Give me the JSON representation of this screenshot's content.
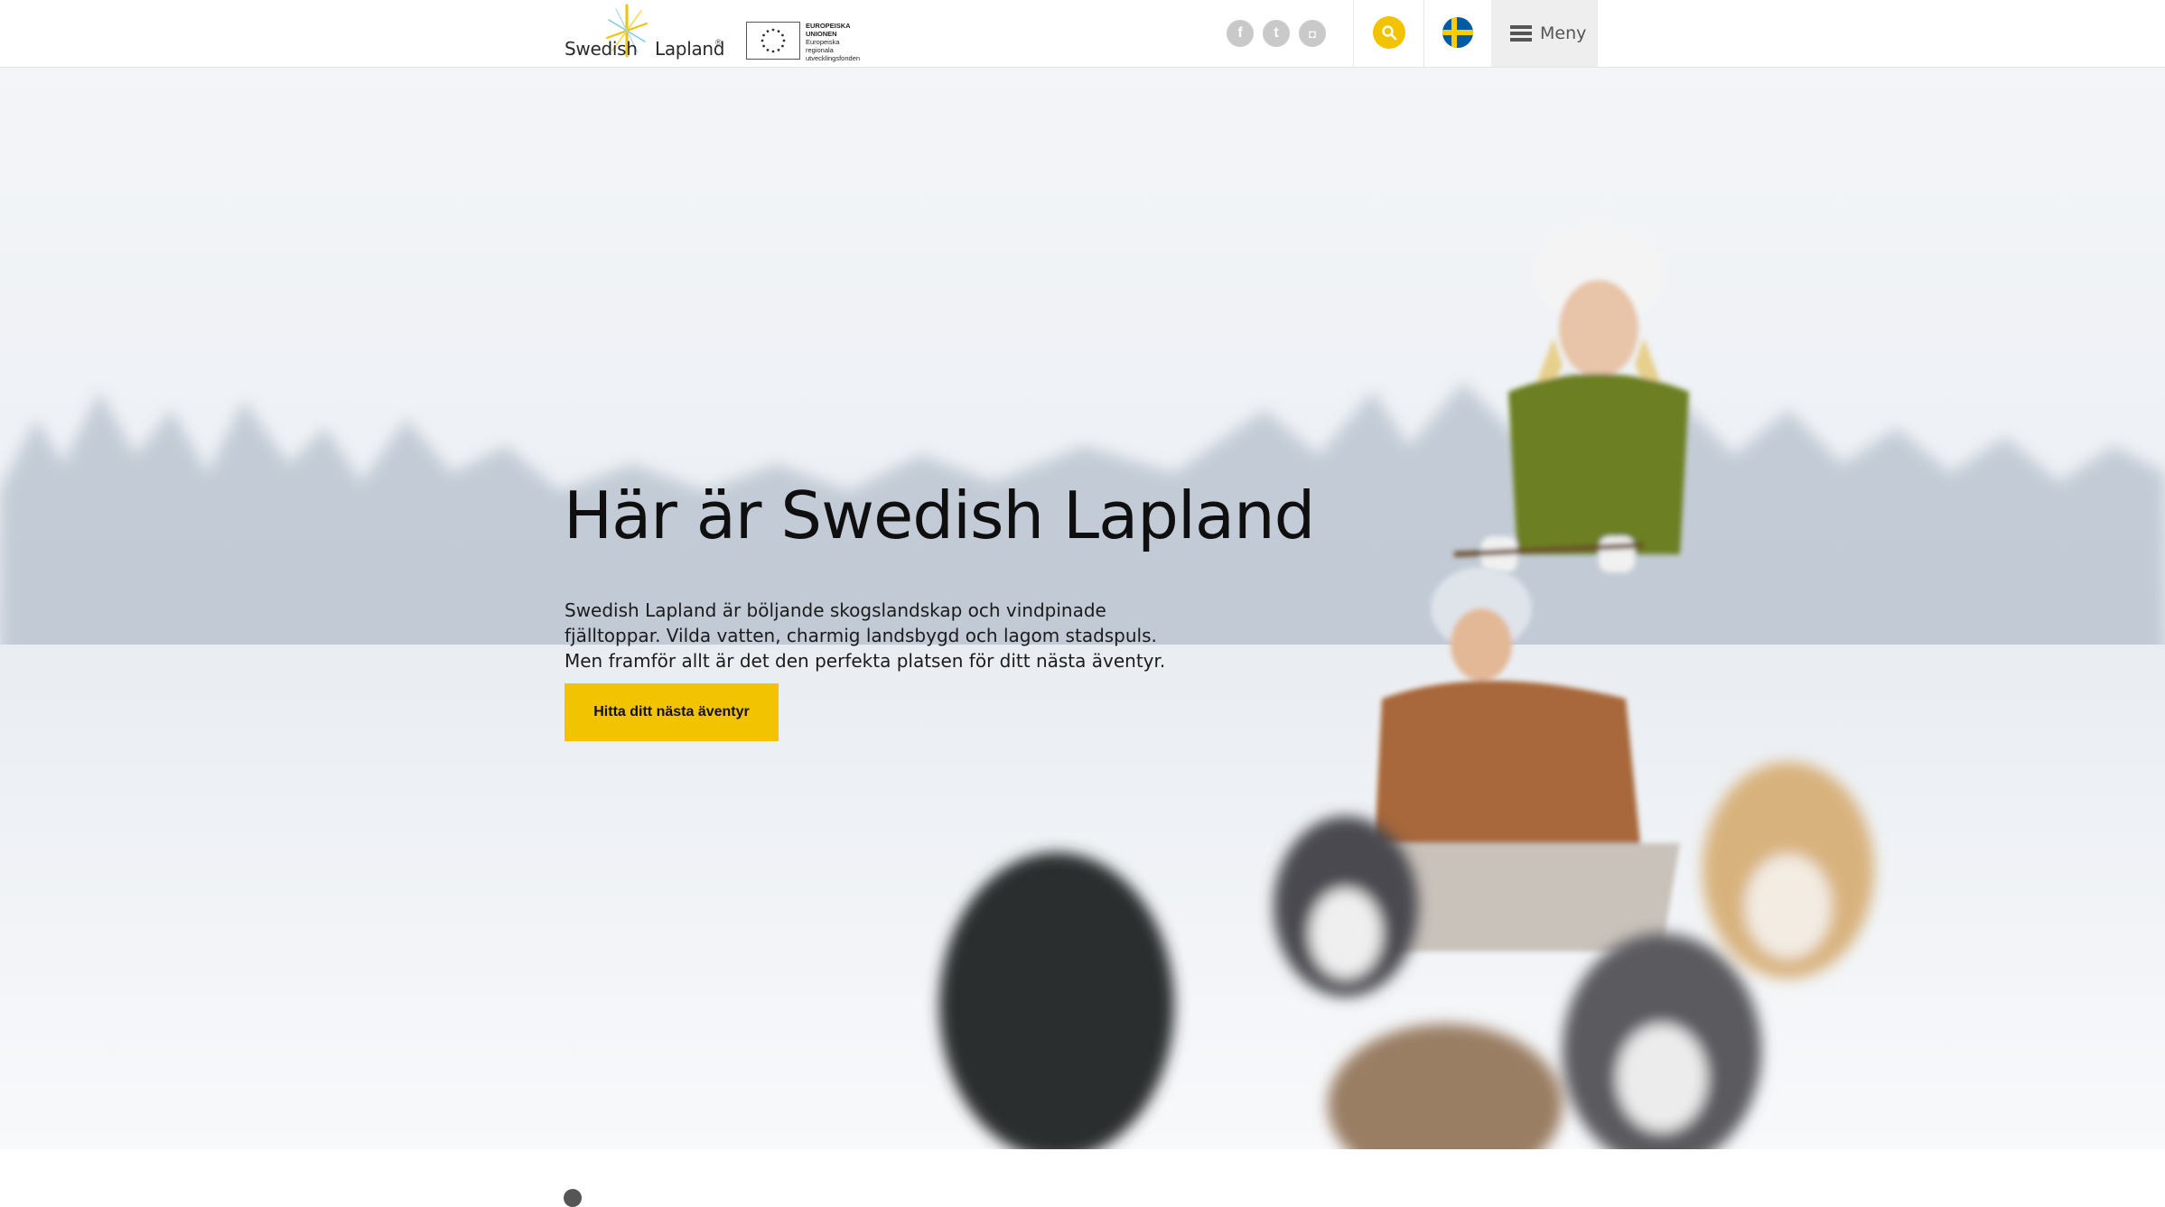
{
  "header": {
    "logo": {
      "word1": "Swedish",
      "word2": "Lapland",
      "reg": "®"
    },
    "eu_badge": {
      "line1": "EUROPEISKA",
      "line2": "UNIONEN",
      "line3": "Europeiska",
      "line4": "regionala",
      "line5": "utvecklingsfonden"
    },
    "social": [
      {
        "name": "facebook-icon",
        "glyph": "f"
      },
      {
        "name": "twitter-icon",
        "glyph": "t"
      },
      {
        "name": "instagram-icon",
        "glyph": "◘"
      }
    ],
    "search_icon": "search-icon",
    "language_flag": "swedish-flag-icon",
    "menu_label": "Meny"
  },
  "hero": {
    "title": "Här är Swedish Lapland",
    "text": "Swedish Lapland är böljande skogslandskap och vindpinade fjälltoppar. Vilda vatten, charmig landsbygd och lagom stadspuls. Men framför allt är det den perfekta platsen för ditt nästa äventyr.",
    "cta_label": "Hitta ditt nästa äventyr"
  },
  "colors": {
    "accent": "#f2c300",
    "header_bg": "#ffffff",
    "menu_bg": "#eeeeee",
    "social_icon_bg": "#c9c9c9",
    "flag_blue": "#005ba5",
    "flag_yellow": "#fecc00"
  }
}
